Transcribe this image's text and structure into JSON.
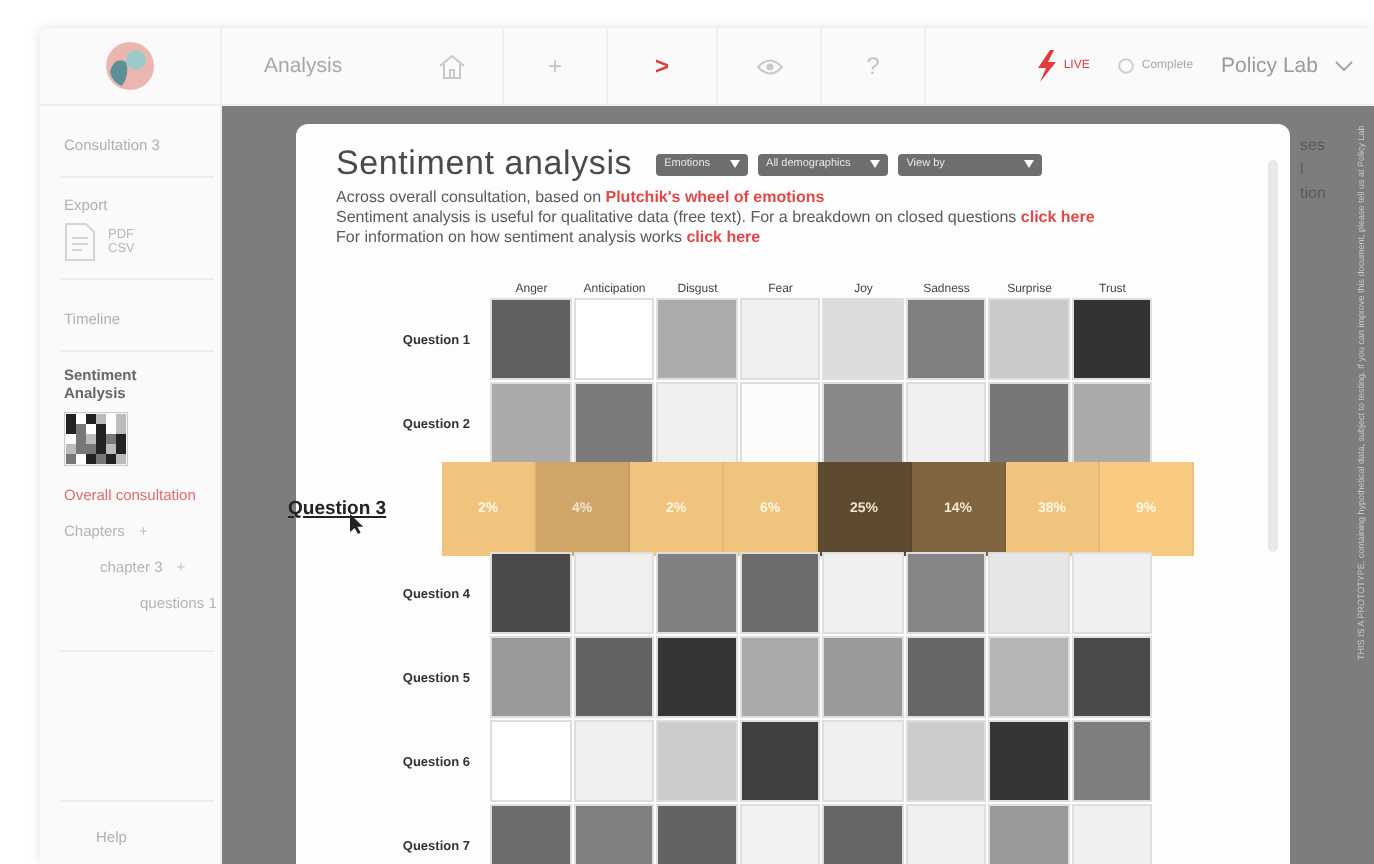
{
  "nav": {
    "title": "Analysis",
    "items": [
      {
        "kind": "home",
        "selected": false
      },
      {
        "kind": "text",
        "label": "+",
        "selected": false
      },
      {
        "kind": "text",
        "label": ">",
        "selected": true
      },
      {
        "kind": "eye",
        "selected": false
      },
      {
        "kind": "text",
        "label": "?",
        "selected": false
      }
    ]
  },
  "status": {
    "live": "LIVE",
    "complete": "Complete",
    "account": "Policy Lab"
  },
  "sidebar": {
    "consultation": "Consultation 3",
    "export": {
      "label": "Export",
      "formats": [
        "PDF",
        "CSV"
      ]
    },
    "timeline": "Timeline",
    "section": "Sentiment Analysis",
    "items": [
      {
        "label": "Overall consultation",
        "selected": true
      },
      {
        "label": "Chapters",
        "selected": false,
        "expander": "+",
        "children": [
          {
            "label": "chapter 3",
            "selected": false,
            "expander": "+",
            "children": [
              {
                "label": "questions 1",
                "selected": false
              }
            ]
          }
        ]
      }
    ],
    "help": "Help"
  },
  "background_fragments": [
    "ses",
    "l",
    "tion"
  ],
  "notice": "THIS IS A PROTOTYPE, containing hypothetical data, subject to testing. If you can improve this document, please tell us at Policy Lab",
  "panel": {
    "title": "Sentiment analysis",
    "dropdowns": [
      "Emotions",
      "All demographics",
      "View by"
    ],
    "lines": [
      {
        "text": "Across overall consultation, based on",
        "link": "Plutchik's wheel of emotions"
      },
      {
        "text": "Sentiment analysis is useful for qualitative data (free text). For a breakdown on closed questions",
        "link": "click here"
      },
      {
        "text": "For information on how sentiment analysis works",
        "link": "click here"
      }
    ],
    "columns": [
      "Anger",
      "Anticipation",
      "Disgust",
      "Fear",
      "Joy",
      "Sadness",
      "Surprise",
      "Trust"
    ],
    "rows": [
      {
        "label": "Question 1",
        "selected": false,
        "cells": [
          {
            "color": "#606060"
          },
          {
            "color": "#ffffff"
          },
          {
            "color": "#acacac"
          },
          {
            "color": "#f0f0f0"
          },
          {
            "color": "#dcdcdc"
          },
          {
            "color": "#808080"
          },
          {
            "color": "#cacaca"
          },
          {
            "color": "#333333"
          }
        ]
      },
      {
        "label": "Question 2",
        "selected": false,
        "cells": [
          {
            "color": "#aaaaaa"
          },
          {
            "color": "#7a7a7a"
          },
          {
            "color": "#f0f0f0"
          },
          {
            "color": "#fcfcfc"
          },
          {
            "color": "#888888"
          },
          {
            "color": "#f0f0f0"
          },
          {
            "color": "#777777"
          },
          {
            "color": "#aaaaaa"
          }
        ]
      },
      {
        "label": "Question 3",
        "selected": true,
        "cells": [
          {
            "value": "2%",
            "color": "#f0c47c"
          },
          {
            "value": "4%",
            "color": "#d0a568"
          },
          {
            "value": "2%",
            "color": "#f0c47c"
          },
          {
            "value": "6%",
            "color": "#f0c47c"
          },
          {
            "value": "25%",
            "color": "#5e4a2e"
          },
          {
            "value": "14%",
            "color": "#806640"
          },
          {
            "value": "38%",
            "color": "#f0c47c"
          },
          {
            "value": "9%",
            "color": "#f9cb82"
          }
        ]
      },
      {
        "label": "Question 4",
        "selected": false,
        "cells": [
          {
            "color": "#4a4a4a"
          },
          {
            "color": "#efefef"
          },
          {
            "color": "#808080"
          },
          {
            "color": "#6c6c6c"
          },
          {
            "color": "#f0f0f0"
          },
          {
            "color": "#858585"
          },
          {
            "color": "#e6e6e6"
          },
          {
            "color": "#f0f0f0"
          }
        ]
      },
      {
        "label": "Question 5",
        "selected": false,
        "cells": [
          {
            "color": "#999999"
          },
          {
            "color": "#626262"
          },
          {
            "color": "#353535"
          },
          {
            "color": "#aaaaaa"
          },
          {
            "color": "#9a9a9a"
          },
          {
            "color": "#666666"
          },
          {
            "color": "#b5b5b5"
          },
          {
            "color": "#4a4a4a"
          }
        ]
      },
      {
        "label": "Question 6",
        "selected": false,
        "cells": [
          {
            "color": "#ffffff"
          },
          {
            "color": "#f0f0f0"
          },
          {
            "color": "#cccccc"
          },
          {
            "color": "#404040"
          },
          {
            "color": "#f0f0f0"
          },
          {
            "color": "#cccccc"
          },
          {
            "color": "#353535"
          },
          {
            "color": "#7f7f7f"
          }
        ]
      },
      {
        "label": "Question 7",
        "selected": false,
        "cells": [
          {
            "color": "#6c6c6c"
          },
          {
            "color": "#808080"
          },
          {
            "color": "#636363"
          },
          {
            "color": "#f2f2f2"
          },
          {
            "color": "#666666"
          },
          {
            "color": "#f0f0f0"
          },
          {
            "color": "#999999"
          },
          {
            "color": "#f0f0f0"
          }
        ]
      }
    ]
  }
}
